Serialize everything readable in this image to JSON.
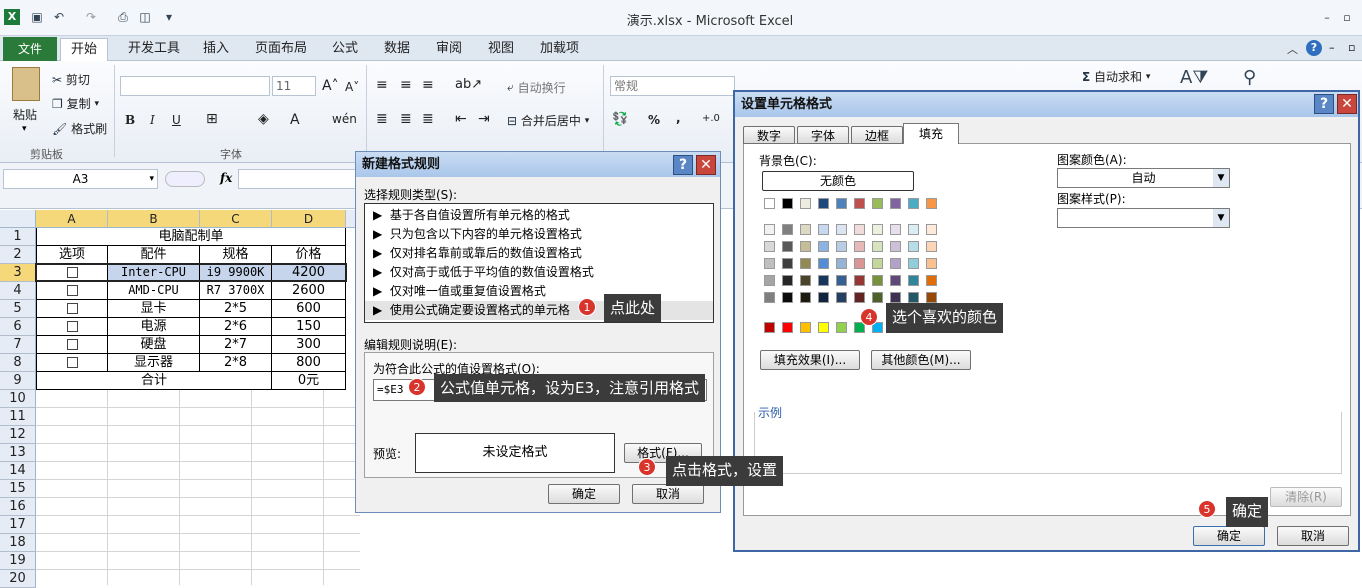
{
  "window": {
    "title": "演示.xlsx - Microsoft Excel"
  },
  "tabs": [
    "文件",
    "开始",
    "开发工具",
    "插入",
    "页面布局",
    "公式",
    "数据",
    "审阅",
    "视图",
    "加载项"
  ],
  "ribbon": {
    "paste": "粘贴",
    "cut": "剪切",
    "copy": "复制",
    "format_painter": "格式刷",
    "clipboard": "剪贴板",
    "font_group": "字体",
    "font_size": "11",
    "wrap_text": "自动换行",
    "merge_center": "合并后居中",
    "number_format": "常规",
    "autosum": "自动求和",
    "bold": "B",
    "italic": "I",
    "underline": "U",
    "percent": "%",
    "comma": ","
  },
  "formula_bar": {
    "name_box": "A3",
    "fx": "fx"
  },
  "sheet": {
    "col_headers": [
      "A",
      "B",
      "C",
      "D"
    ],
    "row_headers": [
      "1",
      "2",
      "3",
      "4",
      "5",
      "6",
      "7",
      "8",
      "9",
      "10",
      "11",
      "12",
      "13",
      "14",
      "15",
      "16",
      "17",
      "18",
      "19",
      "20"
    ],
    "title": "电脑配制单",
    "headers": [
      "选项",
      "配件",
      "规格",
      "价格"
    ],
    "rows": [
      {
        "item": "Inter-CPU",
        "spec": "i9 9900K",
        "price": "4200"
      },
      {
        "item": "AMD-CPU",
        "spec": "R7 3700X",
        "price": "2600"
      },
      {
        "item": "显卡",
        "spec": "2*5",
        "price": "600"
      },
      {
        "item": "电源",
        "spec": "2*6",
        "price": "150"
      },
      {
        "item": "硬盘",
        "spec": "2*7",
        "price": "300"
      },
      {
        "item": "显示器",
        "spec": "2*8",
        "price": "800"
      }
    ],
    "total_label": "合计",
    "total_value": "0元"
  },
  "new_rule_dialog": {
    "title": "新建格式规则",
    "select_label": "选择规则类型(S):",
    "rules": [
      "基于各自值设置所有单元格的格式",
      "只为包含以下内容的单元格设置格式",
      "仅对排名靠前或靠后的数值设置格式",
      "仅对高于或低于平均值的数值设置格式",
      "仅对唯一值或重复值设置格式",
      "使用公式确定要设置格式的单元格"
    ],
    "edit_label": "编辑规则说明(E):",
    "formula_label": "为符合此公式的值设置格式(O):",
    "formula_value": "=$E3",
    "preview_label": "预览:",
    "preview_text": "未设定格式",
    "format_button": "格式(F)...",
    "ok": "确定",
    "cancel": "取消"
  },
  "format_cells_dialog": {
    "title": "设置单元格格式",
    "tabs": [
      "数字",
      "字体",
      "边框",
      "填充"
    ],
    "bg_color_label": "背景色(C):",
    "no_color": "无颜色",
    "pattern_color_label": "图案颜色(A):",
    "pattern_color_value": "自动",
    "pattern_style_label": "图案样式(P):",
    "fill_effects": "填充效果(I)...",
    "more_colors": "其他颜色(M)...",
    "sample_label": "示例",
    "clear": "清除(R)",
    "ok": "确定",
    "cancel": "取消",
    "colors": {
      "theme_top": [
        "#ffffff",
        "#000000",
        "#eeece1",
        "#1f497d",
        "#4f81bd",
        "#c0504d",
        "#9bbb59",
        "#8064a2",
        "#4bacc6",
        "#f79646"
      ],
      "shade_rows": [
        [
          "#f2f2f2",
          "#7f7f7f",
          "#ddd9c3",
          "#c6d9f0",
          "#dbe5f1",
          "#f2dcdb",
          "#ebf1dd",
          "#e5e0ec",
          "#dbeef3",
          "#fdeada"
        ],
        [
          "#d8d8d8",
          "#595959",
          "#c4bd97",
          "#8db3e2",
          "#b8cce4",
          "#e5b9b7",
          "#d7e3bc",
          "#ccc1d9",
          "#b7dde8",
          "#fbd5b5"
        ],
        [
          "#bfbfbf",
          "#3f3f3f",
          "#938953",
          "#548dd4",
          "#95b3d7",
          "#d99694",
          "#c3d69b",
          "#b2a2c7",
          "#92cddc",
          "#fac08f"
        ],
        [
          "#a5a5a5",
          "#262626",
          "#494429",
          "#17365d",
          "#366092",
          "#953734",
          "#76923c",
          "#5f497a",
          "#31859b",
          "#e36c09"
        ],
        [
          "#7f7f7f",
          "#0c0c0c",
          "#1d1b10",
          "#0f243e",
          "#244061",
          "#632423",
          "#4f6128",
          "#3f3151",
          "#205867",
          "#974806"
        ]
      ],
      "standard": [
        "#c00000",
        "#ff0000",
        "#ffc000",
        "#ffff00",
        "#92d050",
        "#00b050",
        "#00b0f0",
        "#0070c0",
        "#002060",
        "#7030a0"
      ]
    }
  },
  "annotations": [
    {
      "num": "1",
      "text": "点此处"
    },
    {
      "num": "2",
      "text": "公式值单元格，设为E3，注意引用格式"
    },
    {
      "num": "3",
      "text": "点击格式，设置"
    },
    {
      "num": "4",
      "text": "选个喜欢的颜色"
    },
    {
      "num": "5",
      "text": "确定"
    }
  ]
}
